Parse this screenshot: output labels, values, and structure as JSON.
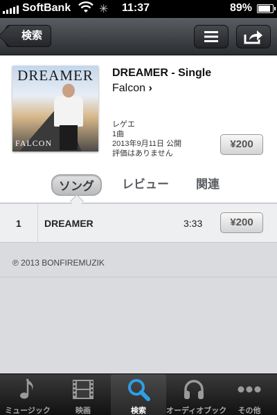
{
  "status_bar": {
    "carrier": "SoftBank",
    "time": "11:37",
    "battery": "89%",
    "battery_level": 0.89
  },
  "nav": {
    "back_label": "検索",
    "list_icon": "list-icon",
    "share_icon": "share-icon"
  },
  "product": {
    "title": "DREAMER - Single",
    "artist": "Falcon",
    "cover_title": "DREAMER",
    "cover_artist": "FALCON",
    "genre": "レゲエ",
    "track_count": "1曲",
    "release": "2013年9月11日 公開",
    "rating": "評価はありません",
    "price": "¥200"
  },
  "tabs": {
    "songs": "ソング",
    "reviews": "レビュー",
    "related": "関連"
  },
  "tracks": [
    {
      "num": "1",
      "name": "DREAMER",
      "time": "3:33",
      "price": "¥200"
    }
  ],
  "copyright": "℗ 2013 BONFIREMUZIK",
  "tabbar": {
    "music": "ミュージック",
    "movies": "映画",
    "search": "検索",
    "audiobooks": "オーディオブック",
    "more": "その他"
  },
  "colors": {
    "active_blue": "#2f9ee6",
    "nav_dark": "#2b2d31"
  }
}
